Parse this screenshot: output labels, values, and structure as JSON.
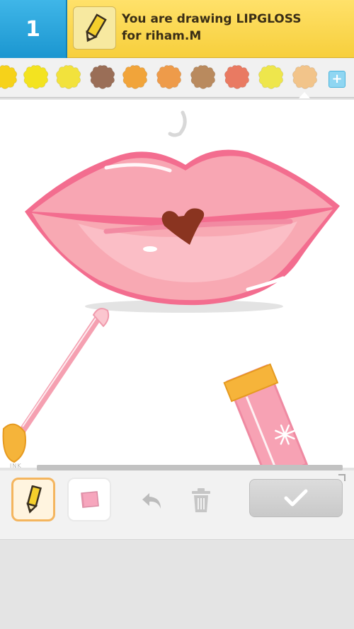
{
  "header": {
    "round_number": "1",
    "prompt_line1": "You are drawing LIPGLOSS",
    "prompt_line2": "for riham.M"
  },
  "palette": {
    "colors": [
      "#f6d21a",
      "#f3e320",
      "#f2e23c",
      "#9a6e57",
      "#f1a43a",
      "#ee9b4a",
      "#b98a5e",
      "#e97a62",
      "#eee64c",
      "#f2c48a"
    ],
    "selected_index": 9,
    "add_label": "+"
  },
  "canvas": {
    "ink_label": "INK"
  },
  "toolbar": {
    "selected_tool": "pencil"
  }
}
